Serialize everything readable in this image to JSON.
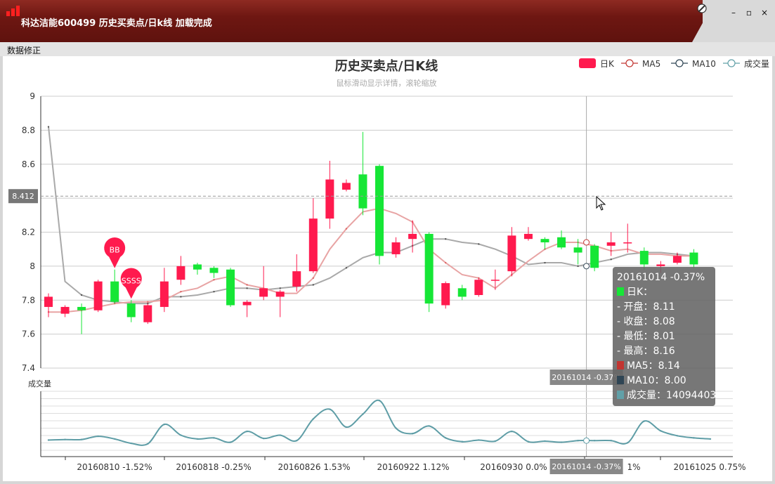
{
  "window": {
    "title": "科达洁能600499  历史买卖点/日k线  加载完成",
    "controls": {
      "minimize": "–",
      "maximize": "▫",
      "close": "×"
    }
  },
  "menu": {
    "items": [
      "数据修正"
    ]
  },
  "colors": {
    "up": "#ff1a4e",
    "down": "#16e636",
    "ma5": "#e8a4a4",
    "ma10": "#a9a9a9",
    "volume": "#5e9da6",
    "titlebar": "#6e1712"
  },
  "chart_data": {
    "type": "candlestick",
    "title": "历史买卖点/日K线",
    "subtitle": "鼠标滑动显示详情，滚轮缩放",
    "legend": {
      "placement": "top-right",
      "items": [
        "日K",
        "MA5",
        "MA10",
        "成交量"
      ]
    },
    "y_axis": {
      "ticks": [
        "7.4",
        "7.6",
        "7.8",
        "8",
        "8.2",
        "8.4",
        "8.6",
        "8.8",
        "9"
      ],
      "ylim": [
        7.4,
        9.0
      ]
    },
    "x_axis": {
      "tick_labels": [
        "20160810 -1.52%",
        "20160818 -0.25%",
        "20160826 1.53%",
        "20160922 1.12%",
        "20160930 0.0%",
        "1%",
        "20161025 0.75%"
      ]
    },
    "volume_axis_label": "成交量",
    "candles": [
      {
        "o": 7.76,
        "c": 7.82,
        "l": 7.7,
        "h": 7.84
      },
      {
        "o": 7.72,
        "c": 7.76,
        "l": 7.7,
        "h": 7.77
      },
      {
        "o": 7.76,
        "c": 7.74,
        "l": 7.6,
        "h": 7.78
      },
      {
        "o": 7.74,
        "c": 7.91,
        "l": 7.73,
        "h": 7.92
      },
      {
        "o": 7.91,
        "c": 7.79,
        "l": 7.78,
        "h": 7.98
      },
      {
        "o": 7.78,
        "c": 7.7,
        "l": 7.67,
        "h": 7.8
      },
      {
        "o": 7.67,
        "c": 7.77,
        "l": 7.66,
        "h": 7.78
      },
      {
        "o": 7.76,
        "c": 7.91,
        "l": 7.73,
        "h": 7.99
      },
      {
        "o": 7.92,
        "c": 8.0,
        "l": 7.89,
        "h": 8.06
      },
      {
        "o": 8.01,
        "c": 7.98,
        "l": 7.95,
        "h": 8.02
      },
      {
        "o": 7.99,
        "c": 7.96,
        "l": 7.93,
        "h": 8.0
      },
      {
        "o": 7.98,
        "c": 7.77,
        "l": 7.76,
        "h": 7.99
      },
      {
        "o": 7.77,
        "c": 7.79,
        "l": 7.7,
        "h": 7.8
      },
      {
        "o": 7.82,
        "c": 7.87,
        "l": 7.8,
        "h": 8.0
      },
      {
        "o": 7.82,
        "c": 7.85,
        "l": 7.7,
        "h": 7.86
      },
      {
        "o": 7.88,
        "c": 7.97,
        "l": 7.85,
        "h": 8.07
      },
      {
        "o": 7.97,
        "c": 8.28,
        "l": 7.96,
        "h": 8.4
      },
      {
        "o": 8.28,
        "c": 8.51,
        "l": 8.22,
        "h": 8.62
      },
      {
        "o": 8.45,
        "c": 8.49,
        "l": 8.44,
        "h": 8.51
      },
      {
        "o": 8.54,
        "c": 8.34,
        "l": 8.3,
        "h": 8.79
      },
      {
        "o": 8.59,
        "c": 8.06,
        "l": 8.01,
        "h": 8.6
      },
      {
        "o": 8.07,
        "c": 8.14,
        "l": 8.05,
        "h": 8.17
      },
      {
        "o": 8.16,
        "c": 8.19,
        "l": 8.08,
        "h": 8.27
      },
      {
        "o": 8.19,
        "c": 7.78,
        "l": 7.73,
        "h": 8.2
      },
      {
        "o": 7.77,
        "c": 7.9,
        "l": 7.75,
        "h": 7.91
      },
      {
        "o": 7.87,
        "c": 7.82,
        "l": 7.8,
        "h": 7.89
      },
      {
        "o": 7.83,
        "c": 7.92,
        "l": 7.82,
        "h": 7.93
      },
      {
        "o": 7.92,
        "c": 7.92,
        "l": 7.86,
        "h": 7.98
      },
      {
        "o": 7.97,
        "c": 8.18,
        "l": 7.94,
        "h": 8.23
      },
      {
        "o": 8.16,
        "c": 8.19,
        "l": 8.15,
        "h": 8.23
      },
      {
        "o": 8.16,
        "c": 8.14,
        "l": 8.1,
        "h": 8.17
      },
      {
        "o": 8.17,
        "c": 8.11,
        "l": 8.1,
        "h": 8.21
      },
      {
        "o": 8.11,
        "c": 8.08,
        "l": 8.01,
        "h": 8.16
      },
      {
        "o": 8.12,
        "c": 7.99,
        "l": 7.97,
        "h": 8.13
      },
      {
        "o": 8.12,
        "c": 8.14,
        "l": 8.06,
        "h": 8.2
      },
      {
        "o": 8.14,
        "c": 8.14,
        "l": 8.08,
        "h": 8.25
      },
      {
        "o": 8.09,
        "c": 8.01,
        "l": 7.98,
        "h": 8.11
      },
      {
        "o": 8.0,
        "c": 8.01,
        "l": 7.96,
        "h": 8.03
      },
      {
        "o": 8.02,
        "c": 8.06,
        "l": 8.01,
        "h": 8.08
      },
      {
        "o": 8.08,
        "c": 8.01,
        "l": 7.99,
        "h": 8.1
      }
    ],
    "ma5": [
      7.73,
      7.73,
      7.74,
      7.76,
      7.78,
      7.79,
      7.79,
      7.8,
      7.85,
      7.87,
      7.92,
      7.94,
      7.89,
      7.87,
      7.84,
      7.84,
      7.93,
      8.1,
      8.22,
      8.32,
      8.34,
      8.31,
      8.26,
      8.1,
      8.02,
      7.95,
      7.93,
      7.87,
      7.95,
      8.03,
      8.1,
      8.14,
      8.14,
      8.12,
      8.09,
      8.1,
      8.07,
      8.07,
      8.06,
      8.06
    ],
    "ma10": [
      8.82,
      7.91,
      7.83,
      7.8,
      7.79,
      7.78,
      7.78,
      7.82,
      7.82,
      7.83,
      7.85,
      7.87,
      7.87,
      7.86,
      7.87,
      7.88,
      7.89,
      7.93,
      7.99,
      8.05,
      8.08,
      8.08,
      8.12,
      8.16,
      8.16,
      8.14,
      8.13,
      8.1,
      8.06,
      8.01,
      8.02,
      8.02,
      8.0,
      8.02,
      8.04,
      8.07,
      8.08,
      8.08,
      8.07,
      8.06
    ],
    "volume": [
      0.15,
      0.16,
      0.16,
      0.22,
      0.17,
      0.09,
      0.08,
      0.44,
      0.24,
      0.17,
      0.19,
      0.11,
      0.31,
      0.18,
      0.24,
      0.14,
      0.54,
      0.72,
      0.39,
      0.63,
      0.88,
      0.37,
      0.27,
      0.41,
      0.19,
      0.12,
      0.15,
      0.13,
      0.31,
      0.12,
      0.13,
      0.11,
      0.14,
      0.14,
      0.14,
      0.1,
      0.5,
      0.32,
      0.23,
      0.19,
      0.17
    ],
    "markers": [
      {
        "index": 4,
        "label": "BB"
      },
      {
        "index": 5,
        "label": "SSSS"
      }
    ],
    "crosshair": {
      "index": 32,
      "price_label": "8.412",
      "price": 8.412,
      "date_label": "20161014 -0.37%"
    },
    "tooltip": {
      "header": "20161014 -0.37%",
      "rows": [
        {
          "label": "日K：",
          "color": "#16e636"
        },
        {
          "label": "- 开盘：8.11"
        },
        {
          "label": "- 收盘：8.08"
        },
        {
          "label": "- 最低：8.01"
        },
        {
          "label": "- 最高：8.16"
        },
        {
          "label": "MA5：8.14",
          "color": "#c23531"
        },
        {
          "label": "MA10：8.00",
          "color": "#2f4554"
        },
        {
          "label": "成交量：14094403",
          "color": "#61a0a8"
        }
      ]
    }
  }
}
